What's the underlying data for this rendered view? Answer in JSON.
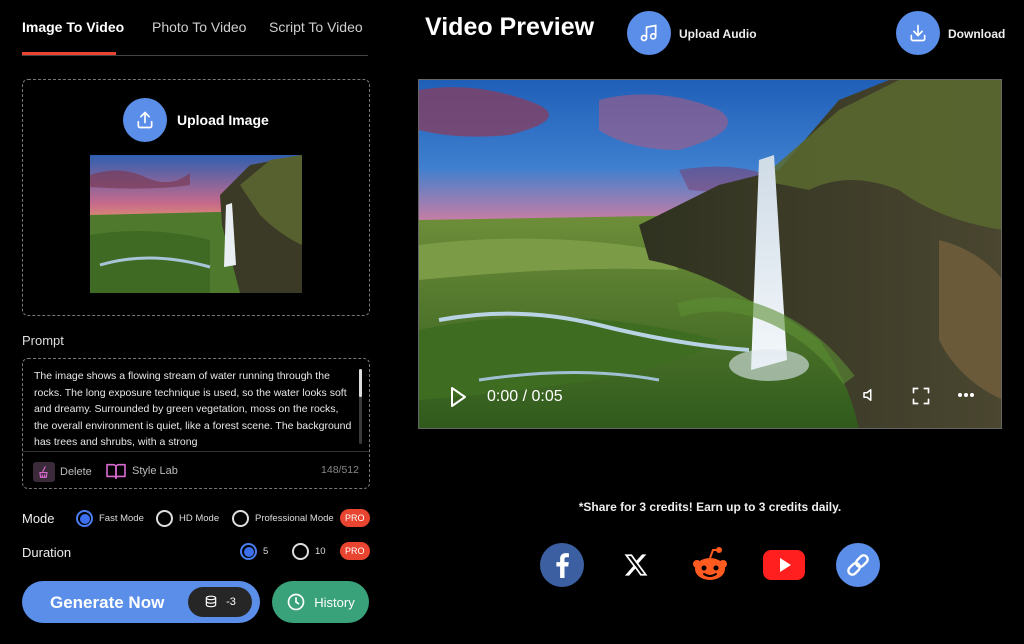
{
  "tabs": [
    {
      "label": "Image To Video",
      "active": true
    },
    {
      "label": "Photo To Video",
      "active": false
    },
    {
      "label": "Script To Video",
      "active": false
    }
  ],
  "upload": {
    "label": "Upload Image"
  },
  "prompt": {
    "title": "Prompt",
    "text": "The image shows a flowing stream of water running through the rocks. The long exposure technique is used, so the water looks soft and dreamy. Surrounded by green vegetation, moss on the rocks, the overall environment is quiet, like a forest scene. The background has trees and shrubs, with a strong",
    "delete_label": "Delete",
    "style_lab_label": "Style Lab",
    "char_count": "148/512"
  },
  "mode": {
    "label": "Mode",
    "options": [
      {
        "label": "Fast Mode",
        "selected": true
      },
      {
        "label": "HD Mode",
        "selected": false
      },
      {
        "label": "Professional Mode",
        "selected": false
      }
    ],
    "pro_badge": "PRO"
  },
  "duration": {
    "label": "Duration",
    "options": [
      {
        "label": "5",
        "selected": true
      },
      {
        "label": "10",
        "selected": false
      }
    ],
    "pro_badge": "PRO"
  },
  "generate": {
    "label": "Generate Now",
    "credits": "-3"
  },
  "history": {
    "label": "History"
  },
  "preview": {
    "title": "Video Preview",
    "upload_audio_label": "Upload Audio",
    "download_label": "Download",
    "time": "0:00 / 0:05",
    "progress": 0
  },
  "share": {
    "text": "*Share for 3 credits! Earn up to 3 credits daily.",
    "icons": [
      "facebook-icon",
      "x-icon",
      "reddit-icon",
      "youtube-icon",
      "link-icon"
    ]
  },
  "colors": {
    "accent_blue": "#5b8ee8",
    "accent_red": "#e8442f",
    "history_green": "#3aa27a"
  }
}
